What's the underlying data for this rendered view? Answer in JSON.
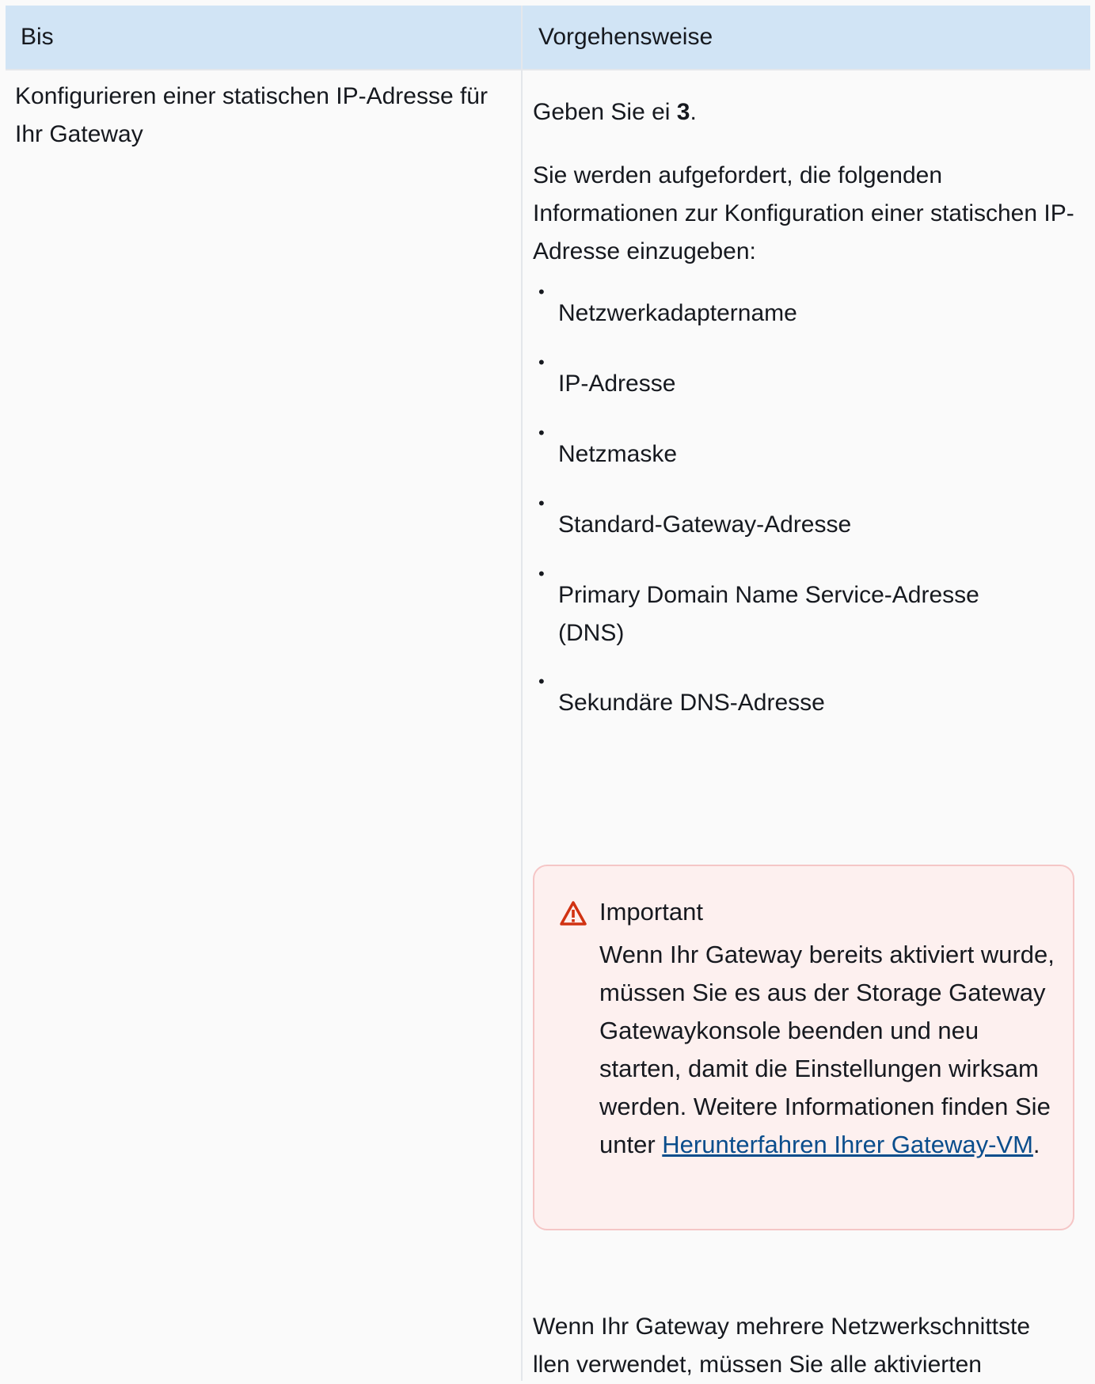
{
  "table": {
    "header": {
      "col1": "Bis",
      "col2": "Vorgehensweise"
    },
    "row": {
      "task": "Konfigurieren einer statischen IP-Adresse für Ihr Gateway",
      "step_prefix": "Geben Sie ei ",
      "step_key": "3",
      "step_suffix": ".",
      "prompt_text": "Sie werden aufgefordert, die folgenden Informationen zur Konfiguration einer statischen IP-Adresse einzugeben:",
      "items": [
        "Netzwerkadaptername",
        "IP-Adresse",
        "Netzmaske",
        "Standard-Gateway-Adresse",
        "Primary Domain Name Service-Adresse (DNS)",
        "Sekundäre DNS-Adresse"
      ],
      "bullet": "•",
      "alert": {
        "title": "Important",
        "body_before": "Wenn Ihr Gateway bereits aktiviert wurde, müssen Sie es aus der Storage Gateway Gatewaykonsole beenden und neu starten, damit die Einstellungen wirksam werden. Weitere Informationen finden Sie unter ",
        "link": "Herunterfahren Ihrer Gateway-VM",
        "body_after": ".",
        "icon": "warning-icon",
        "colors": {
          "border": "#f5c6c6",
          "background": "#fdf0ef",
          "icon": "#d13212"
        }
      },
      "final_text": "Wenn Ihr Gateway mehrere Netzwerkschnittste llen verwendet, müssen Sie alle aktivierten"
    },
    "colors": {
      "header_bg": "#d1e4f5",
      "link": "#0a4d8c"
    }
  }
}
